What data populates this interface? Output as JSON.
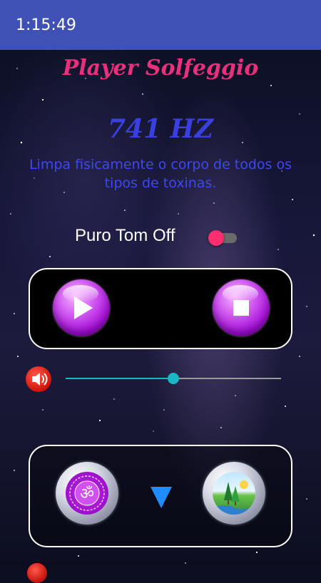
{
  "status_bar": {
    "time": "1:15:49"
  },
  "header": {
    "title": "Player Solfeggio"
  },
  "frequency": {
    "value": "741 HZ",
    "description": "Limpa fisicamente o corpo de todos os tipos de toxinas."
  },
  "pure_tone": {
    "label": "Puro Tom Off",
    "enabled": false
  },
  "controls": {
    "play_icon": "play-icon",
    "stop_icon": "stop-icon"
  },
  "volume": {
    "icon": "speaker-icon",
    "level": 0.5
  },
  "navigation": {
    "left_icon": "om-symbol-icon",
    "center_icon": "down-arrow-icon",
    "right_icon": "nature-landscape-icon"
  },
  "colors": {
    "title": "#e8317a",
    "frequency": "#3a3fe0",
    "description": "#3d48f2",
    "status_bar": "#3f51b5",
    "switch_thumb": "#ff2e6e",
    "slider_accent": "#19b7c4",
    "down_arrow": "#1f8cff"
  }
}
